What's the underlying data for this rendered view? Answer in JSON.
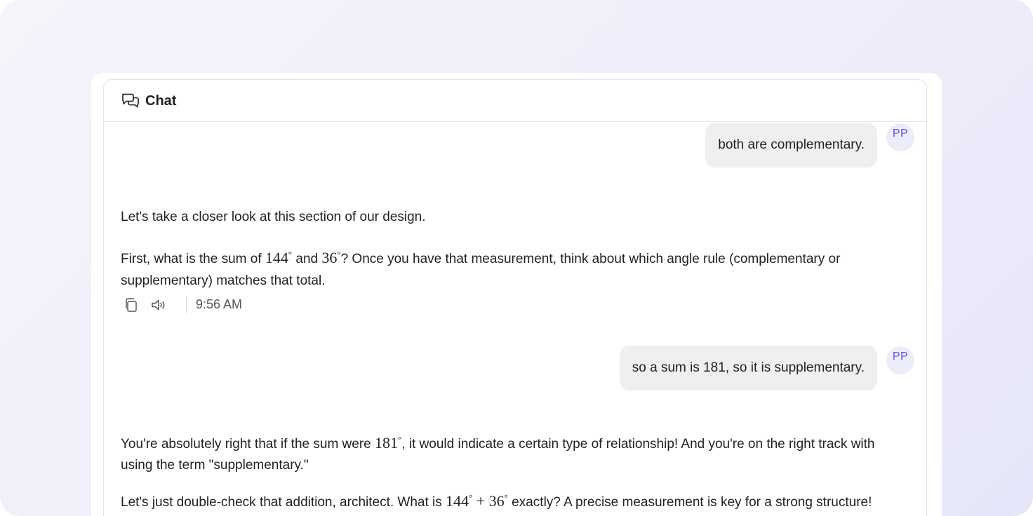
{
  "header": {
    "title": "Chat",
    "icon": "chat-bubbles-icon"
  },
  "messages": [
    {
      "role": "user",
      "avatar": "PP",
      "text": "both are complementary."
    },
    {
      "role": "assistant",
      "paragraphs": {
        "p1": "Let's take a closer look at this section of our design.",
        "p2_a": "First, what is the sum of ",
        "p2_m1": "144",
        "p2_b": " and ",
        "p2_m2": "36",
        "p2_c": "? Once you have that measurement, think about which angle rule (complementary or supplementary) matches that total."
      },
      "actions": {
        "copy_icon": "copy-icon",
        "speak_icon": "speaker-icon",
        "timestamp": "9:56 AM"
      }
    },
    {
      "role": "user",
      "avatar": "PP",
      "text": "so a sum is 181, so it is supplementary."
    },
    {
      "role": "assistant",
      "paragraphs": {
        "p1_a": "You're absolutely right that if the sum were ",
        "p1_m1": "181",
        "p1_b": ", it would indicate a certain type of relationship! And you're on the right track with using the term \"supplementary.\"",
        "p2_a": "Let's just double-check that addition, architect. What is ",
        "p2_m1": "144",
        "p2_plus": "+",
        "p2_m2": "36",
        "p2_b": " exactly? A precise measurement is key for a strong structure!"
      }
    }
  ],
  "math_symbols": {
    "degree": "°"
  }
}
